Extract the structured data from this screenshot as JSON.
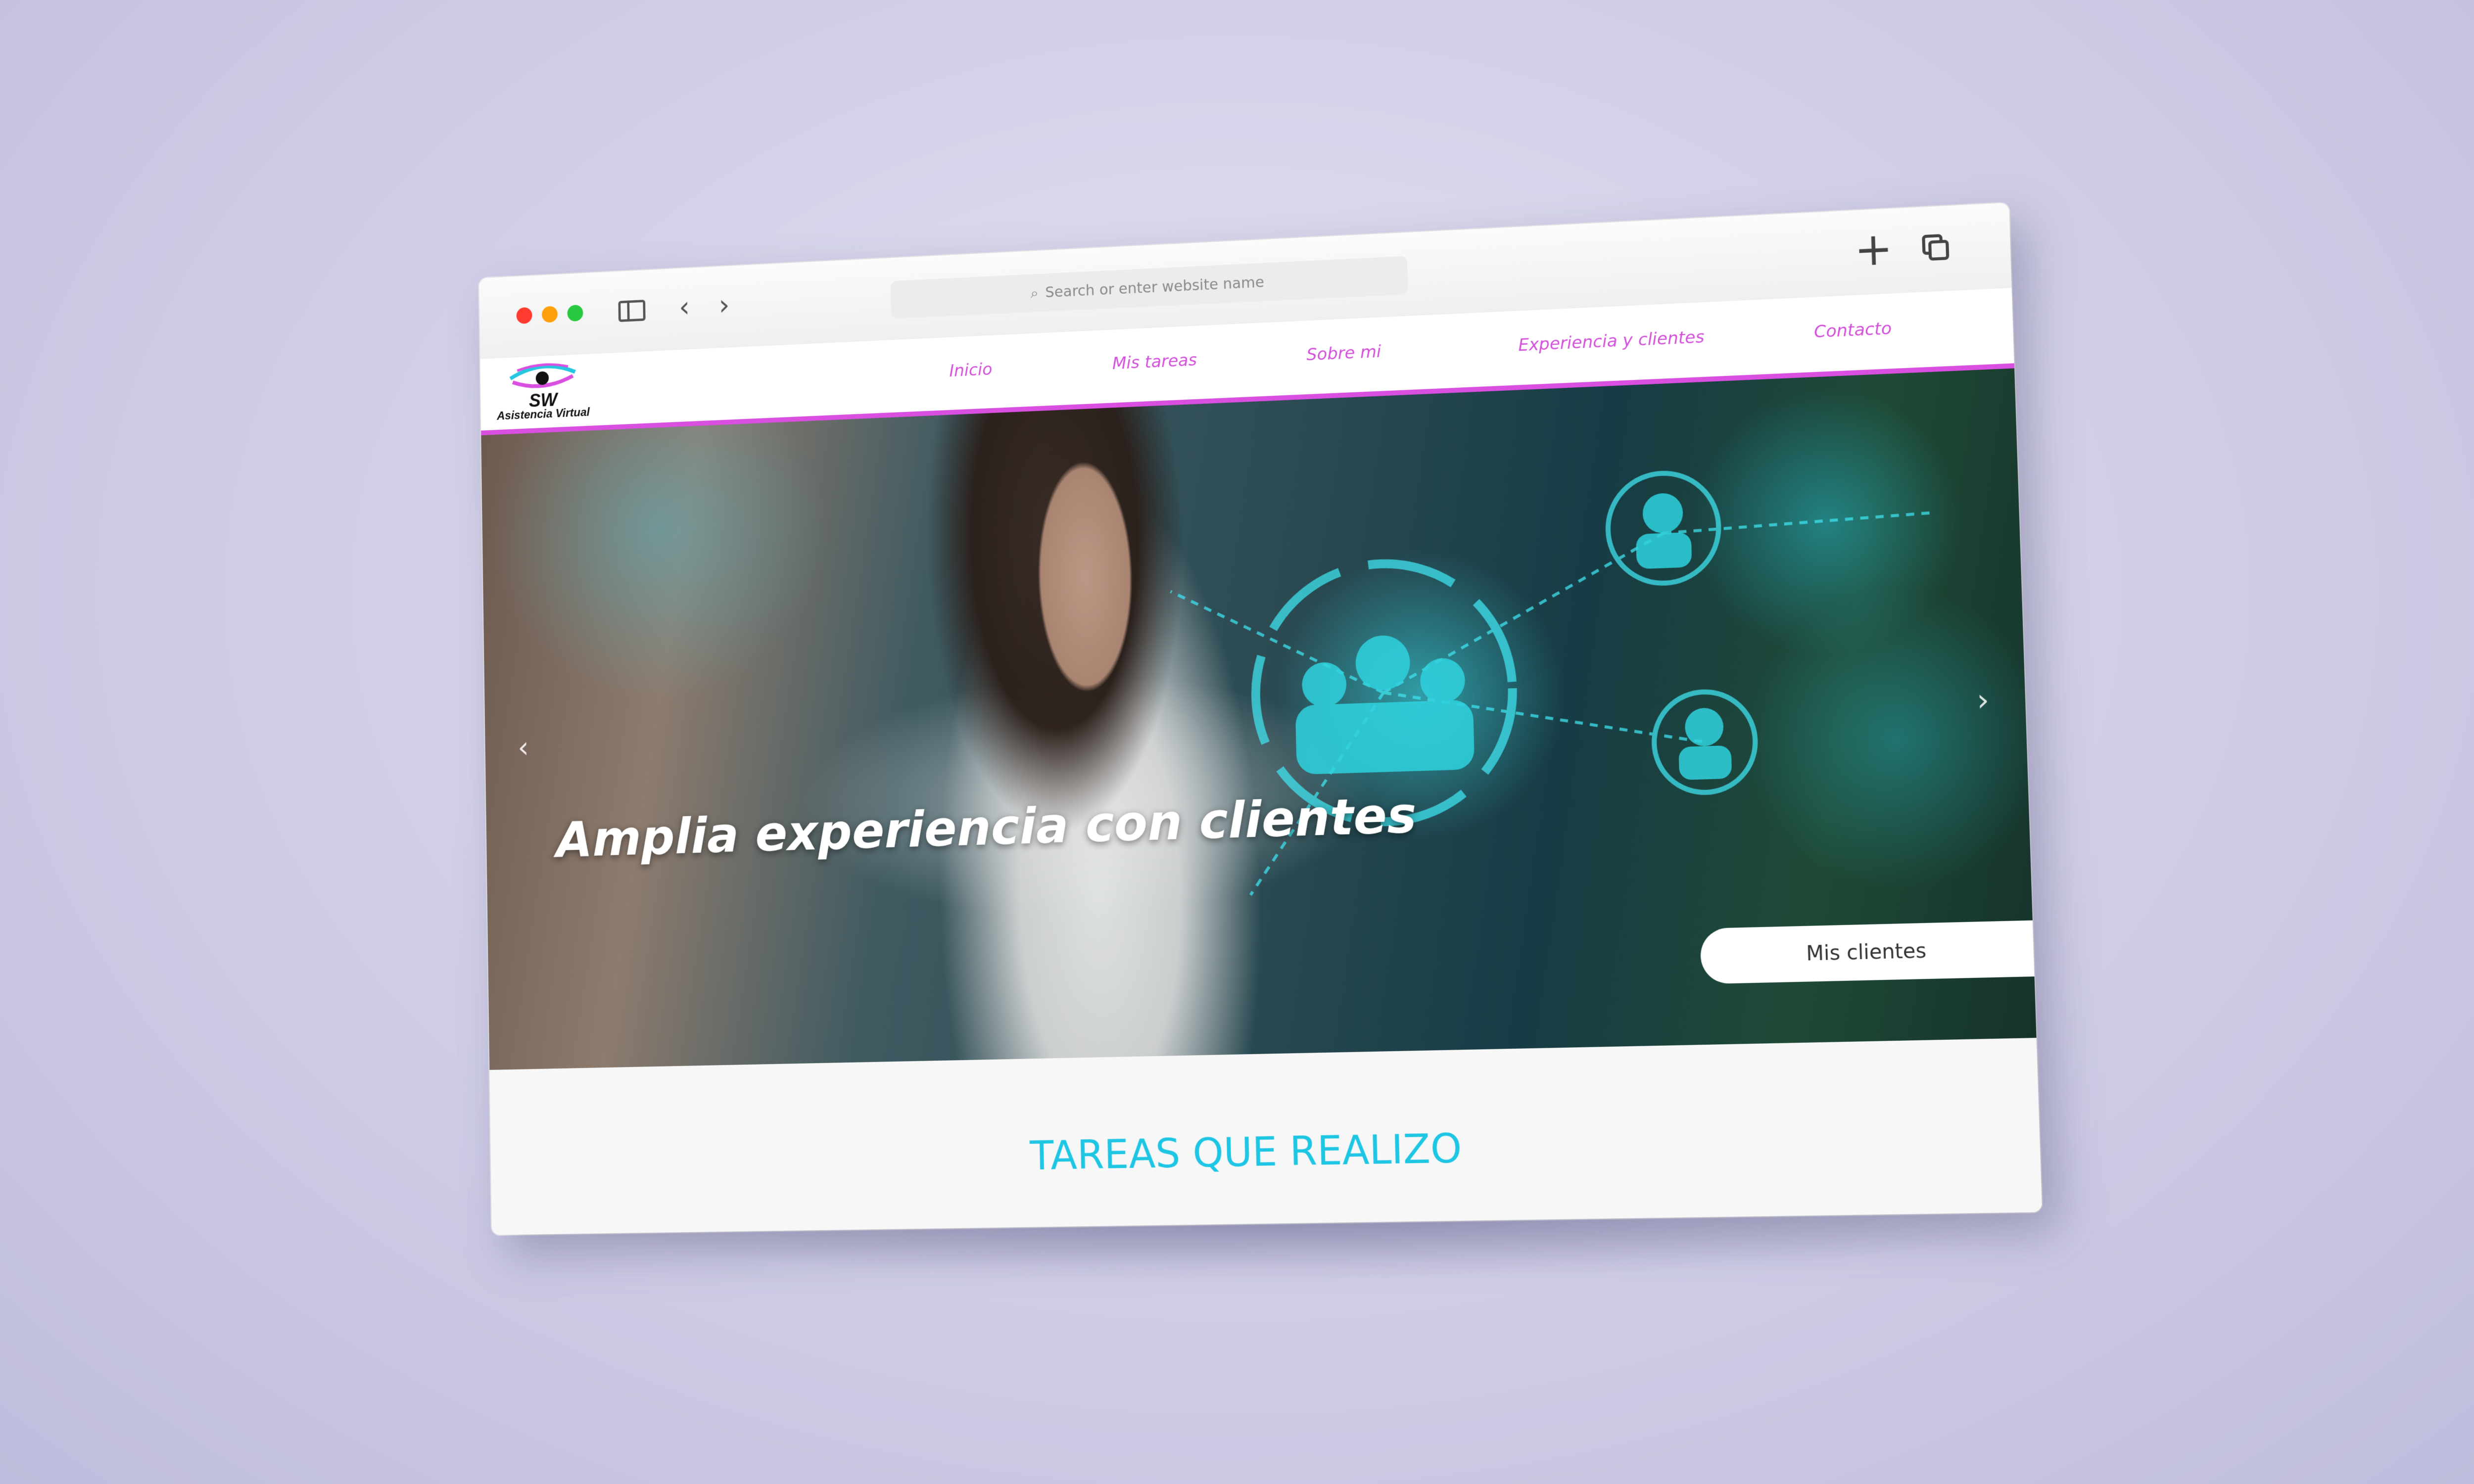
{
  "browser": {
    "address_placeholder": "Search or enter website name",
    "icons": [
      "close-dot",
      "minimize-dot",
      "zoom-dot",
      "sidebar-icon",
      "back-icon",
      "forward-icon",
      "search-icon",
      "new-tab-icon",
      "tabs-overview-icon"
    ]
  },
  "site": {
    "logo": {
      "name": "SW",
      "tagline": "Asistencia Virtual"
    },
    "menu": [
      {
        "label": "Inicio"
      },
      {
        "label": "Mis tareas"
      },
      {
        "label": "Sobre mi"
      },
      {
        "label": "Experiencia y clientes"
      },
      {
        "label": "Contacto"
      }
    ],
    "accent_color": "#d94fe0",
    "hero": {
      "title": "Amplia experiencia con clientes",
      "button_label": "Mis clientes",
      "prev_icon": "chevron-left-icon",
      "next_icon": "chevron-right-icon"
    },
    "section": {
      "title": "TAREAS QUE REALIZO",
      "title_color": "#1fc6e4"
    }
  }
}
